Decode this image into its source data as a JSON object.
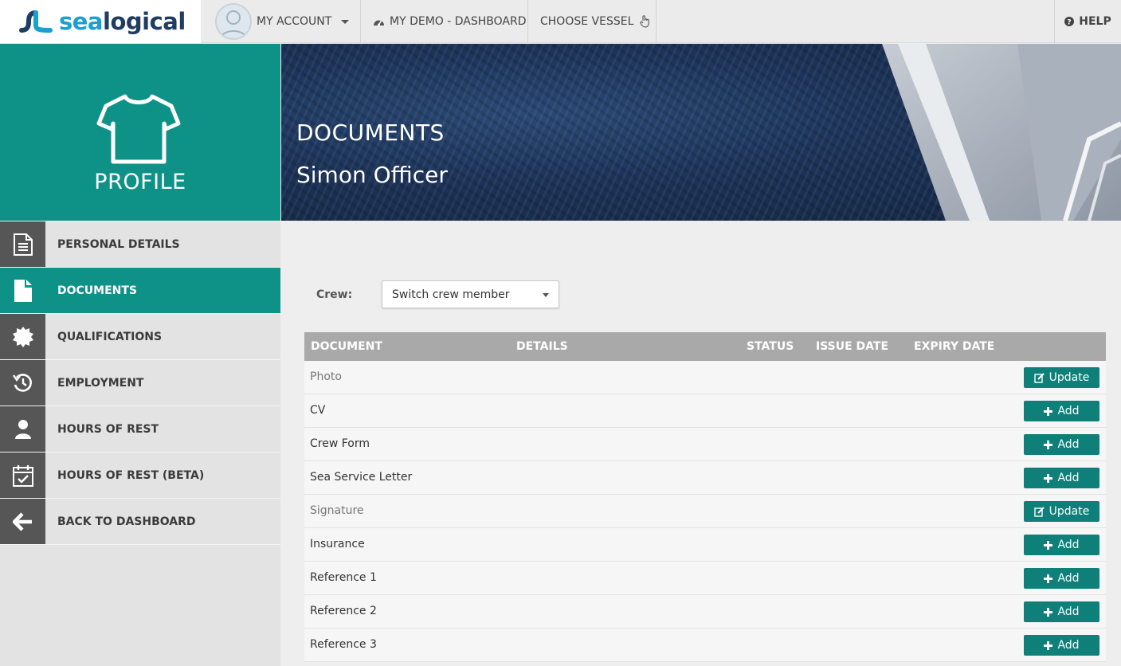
{
  "brand": {
    "logo_part1": "sea",
    "logo_part2": "logical"
  },
  "topnav": {
    "account_label": "MY ACCOUNT",
    "dashboard_label": "MY DEMO - DASHBOARD",
    "vessel_label": "CHOOSE VESSEL",
    "help_label": "HELP"
  },
  "sidebar": {
    "profile_title": "PROFILE",
    "items": [
      {
        "label": "PERSONAL DETAILS",
        "icon": "document-lines-icon"
      },
      {
        "label": "DOCUMENTS",
        "icon": "file-icon",
        "active": true
      },
      {
        "label": "QUALIFICATIONS",
        "icon": "badge-icon"
      },
      {
        "label": "EMPLOYMENT",
        "icon": "history-icon"
      },
      {
        "label": "HOURS OF REST",
        "icon": "user-icon"
      },
      {
        "label": "HOURS OF REST (BETA)",
        "icon": "calendar-check-icon"
      },
      {
        "label": "BACK TO DASHBOARD",
        "icon": "arrow-left-icon"
      }
    ]
  },
  "hero": {
    "title": "DOCUMENTS",
    "subtitle": "Simon Officer"
  },
  "crew": {
    "label": "Crew:",
    "select_value": "Switch crew member"
  },
  "table": {
    "headers": {
      "document": "DOCUMENT",
      "details": "DETAILS",
      "status": "STATUS",
      "issue_date": "ISSUE DATE",
      "expiry_date": "EXPIRY DATE"
    },
    "rows": [
      {
        "name": "Photo",
        "action": "Update"
      },
      {
        "name": "CV",
        "action": "Add"
      },
      {
        "name": "Crew Form",
        "action": "Add"
      },
      {
        "name": "Sea Service Letter",
        "action": "Add"
      },
      {
        "name": "Signature",
        "action": "Update"
      },
      {
        "name": "Insurance",
        "action": "Add"
      },
      {
        "name": "Reference 1",
        "action": "Add"
      },
      {
        "name": "Reference 2",
        "action": "Add"
      },
      {
        "name": "Reference 3",
        "action": "Add"
      }
    ]
  },
  "colors": {
    "accent": "#0e9287",
    "button": "#0e8079",
    "sidebar_icon_bg": "#565656",
    "table_header": "#a9a9a9"
  }
}
